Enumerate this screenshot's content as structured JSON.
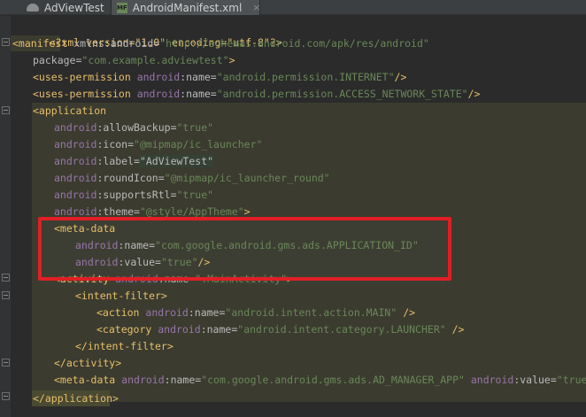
{
  "tabs": [
    {
      "label": "AdViewTest",
      "icon": "android-module-icon"
    },
    {
      "label": "AndroidManifest.xml",
      "icon": "manifest-file-icon",
      "badge": "MF",
      "close": "×"
    }
  ],
  "code": {
    "l1": "<?xml version=\"1.0\" encoding=\"utf-8\"?>",
    "l2_tag": "<manifest",
    "l2_attr": " xmlns:android",
    "l2_eq": "=",
    "l2_val": "\"http://schemas.android.com/apk/res/android\"",
    "l3_attr": "package",
    "l3_eq": "=",
    "l3_val": "\"com.example.adviewtest\"",
    "l3_end": ">",
    "l4_tag": "<uses-permission",
    "l4_ns": " android",
    "l4_attr": ":name",
    "l4_eq": "=",
    "l4_val": "\"android.permission.INTERNET\"",
    "l4_end": "/>",
    "l5_tag": "<uses-permission",
    "l5_ns": " android",
    "l5_attr": ":name",
    "l5_eq": "=",
    "l5_val": "\"android.permission.ACCESS_NETWORK_STATE\"",
    "l5_end": "/>",
    "l6_tag": "<application",
    "l7_ns": "android",
    "l7_attr": ":allowBackup",
    "l7_eq": "=",
    "l7_val": "\"true\"",
    "l8_ns": "android",
    "l8_attr": ":icon",
    "l8_eq": "=",
    "l8_val": "\"@mipmap/ic_launcher\"",
    "l9_ns": "android",
    "l9_attr": ":label",
    "l9_eq": "=",
    "l9_val": "\"AdViewTest\"",
    "l10_ns": "android",
    "l10_attr": ":roundIcon",
    "l10_eq": "=",
    "l10_val": "\"@mipmap/ic_launcher_round\"",
    "l11_ns": "android",
    "l11_attr": ":supportsRtl",
    "l11_eq": "=",
    "l11_val": "\"true\"",
    "l12_ns": "android",
    "l12_attr": ":theme",
    "l12_eq": "=",
    "l12_val": "\"@style/AppTheme\"",
    "l12_end": ">",
    "l13_tag": "<meta-data",
    "l14_ns": "android",
    "l14_attr": ":name",
    "l14_eq": "=",
    "l14_val": "\"com.google.android.gms.ads.APPLICATION_ID\"",
    "l15_ns": "android",
    "l15_attr": ":value",
    "l15_eq": "=",
    "l15_val": "\"true\"",
    "l15_end": "/>",
    "l16_tag": "<activity",
    "l16_ns": " android",
    "l16_attr": ":name",
    "l16_eq": "=",
    "l16_val": "\".MainActivity\"",
    "l16_end": ">",
    "l17_tag": "<intent-filter>",
    "l18_tag": "<action",
    "l18_ns": " android",
    "l18_attr": ":name",
    "l18_eq": "=",
    "l18_val": "\"android.intent.action.MAIN\"",
    "l18_end": " />",
    "l19_tag": "<category",
    "l19_ns": " android",
    "l19_attr": ":name",
    "l19_eq": "=",
    "l19_val": "\"android.intent.category.LAUNCHER\"",
    "l19_end": " />",
    "l20_tag": "</intent-filter>",
    "l21_tag": "</activity>",
    "l22_tag": "<meta-data",
    "l22_ns": " android",
    "l22_attr": ":name",
    "l22_eq": "=",
    "l22_val": "\"com.google.android.gms.ads.AD_MANAGER_APP\"",
    "l22_ns2": " android",
    "l22_attr2": ":value",
    "l22_eq2": "=",
    "l22_val2": "\"true\"",
    "l22_end": " />",
    "l23_tag": "</application>"
  },
  "colors": {
    "background": "#2b2b2b",
    "tag": "#e8bf6a",
    "attribute": "#9876aa",
    "value": "#6a8759",
    "annotation_box": "#e01f25"
  }
}
